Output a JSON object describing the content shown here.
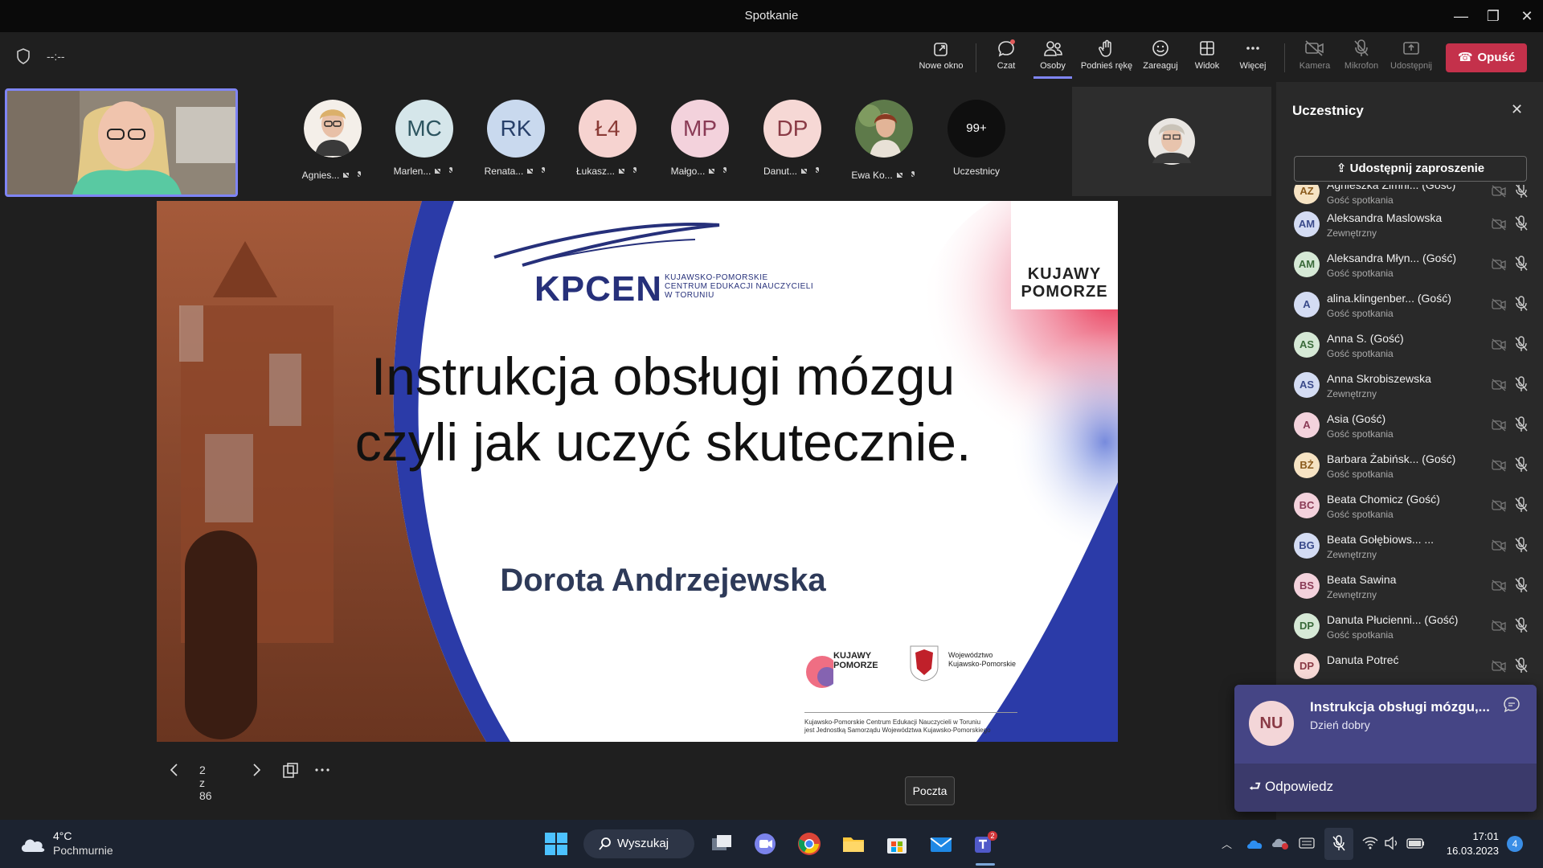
{
  "window": {
    "title": "Spotkanie"
  },
  "meeting": {
    "timer": "--:--"
  },
  "toolbar": {
    "new_window": "Nowe okno",
    "chat": "Czat",
    "people": "Osoby",
    "raise_hand": "Podnieś rękę",
    "react": "Zareaguj",
    "view": "Widok",
    "more": "Więcej",
    "camera": "Kamera",
    "mic": "Mikrofon",
    "share": "Udostępnij",
    "leave": "Opuść"
  },
  "strip": {
    "tiles": [
      {
        "initials": "",
        "name": "Agnies...",
        "color": "#f2d7c9"
      },
      {
        "initials": "MC",
        "name": "Marlen...",
        "color": "#d5e6ea"
      },
      {
        "initials": "RK",
        "name": "Renata...",
        "color": "#c9d9ee"
      },
      {
        "initials": "Ł4",
        "name": "Łukasz...",
        "color": "#f6d3d0"
      },
      {
        "initials": "MP",
        "name": "Małgo...",
        "color": "#f3d2dc"
      },
      {
        "initials": "DP",
        "name": "Danut...",
        "color": "#f6d8d5"
      },
      {
        "initials": "",
        "name": "Ewa Ko...",
        "color": "#6f8a5a"
      }
    ],
    "overflow_count": "99+",
    "overflow_label": "Uczestnicy"
  },
  "slide": {
    "logo_text": "KPCEN",
    "logo_sub": [
      "KUJAWSKO-POMORSKIE",
      "CENTRUM EDUKACJI NAUCZYCIELI",
      "W TORUNIU"
    ],
    "region_badge": [
      "KUJAWY",
      "POMORZE"
    ],
    "title_line1": "Instrukcja obsługi mózgu",
    "title_line2": "czyli jak uczyć skutecznie.",
    "author": "Dorota Andrzejewska",
    "small_logo": [
      "KUJAWY",
      "POMORZE"
    ],
    "voivodeship": [
      "Województwo",
      "Kujawsko-Pomorskie"
    ],
    "footer": [
      "Kujawsko-Pomorskie Centrum Edukacji Nauczycieli w Toruniu",
      "jest Jednostką Samorządu Województwa Kujawsko-Pomorskiego"
    ]
  },
  "slide_nav": {
    "page": "2 z 86"
  },
  "panel": {
    "title": "Uczestnicy",
    "invite": "Udostępnij zaproszenie",
    "participants": [
      {
        "initials": "AZ",
        "name": "Agnieszka Zimni... (Gość)",
        "role": "Gość spotkania",
        "bg": "#f6e3c3",
        "fg": "#8a5a1c"
      },
      {
        "initials": "AM",
        "name": "Aleksandra Maslowska",
        "role": "Zewnętrzny",
        "bg": "#d4dcf3",
        "fg": "#3a4a8a"
      },
      {
        "initials": "AM",
        "name": "Aleksandra Młyn... (Gość)",
        "role": "Gość spotkania",
        "bg": "#d6e9d6",
        "fg": "#3a6a3a"
      },
      {
        "initials": "A",
        "name": "alina.klingenber... (Gość)",
        "role": "Gość spotkania",
        "bg": "#d4dcf3",
        "fg": "#3a4a8a"
      },
      {
        "initials": "AS",
        "name": "Anna S. (Gość)",
        "role": "Gość spotkania",
        "bg": "#d6e9d6",
        "fg": "#3a6a3a"
      },
      {
        "initials": "AS",
        "name": "Anna Skrobiszewska",
        "role": "Zewnętrzny",
        "bg": "#d4dcf3",
        "fg": "#3a4a8a"
      },
      {
        "initials": "A",
        "name": "Asia (Gość)",
        "role": "Gość spotkania",
        "bg": "#f3d2dc",
        "fg": "#8a3b56"
      },
      {
        "initials": "BŻ",
        "name": "Barbara Żabińsk... (Gość)",
        "role": "Gość spotkania",
        "bg": "#f6e3c3",
        "fg": "#8a5a1c"
      },
      {
        "initials": "BC",
        "name": "Beata Chomicz (Gość)",
        "role": "Gość spotkania",
        "bg": "#f3d2dc",
        "fg": "#8a3b56"
      },
      {
        "initials": "BG",
        "name": "Beata Gołębiows... ...",
        "role": "Zewnętrzny",
        "bg": "#d4dcf3",
        "fg": "#3a4a8a"
      },
      {
        "initials": "BS",
        "name": "Beata Sawina",
        "role": "Zewnętrzny",
        "bg": "#f3d2dc",
        "fg": "#8a3b56"
      },
      {
        "initials": "DP",
        "name": "Danuta Płucienni... (Gość)",
        "role": "Gość spotkania",
        "bg": "#d6e9d6",
        "fg": "#3a6a3a"
      },
      {
        "initials": "DP",
        "name": "Danuta Potreć",
        "role": "",
        "bg": "#f6d8d5",
        "fg": "#8a3b46"
      }
    ]
  },
  "toast": {
    "initials": "NU",
    "title": "Instrukcja obsługi mózgu,...",
    "message": "Dzień dobry",
    "reply": "Odpowiedz"
  },
  "tooltip": {
    "text": "Poczta"
  },
  "taskbar": {
    "weather_temp": "4°C",
    "weather_desc": "Pochmurnie",
    "search": "Wyszukaj",
    "teams_badge": "2",
    "time": "17:01",
    "date": "16.03.2023",
    "notifications": "4"
  }
}
